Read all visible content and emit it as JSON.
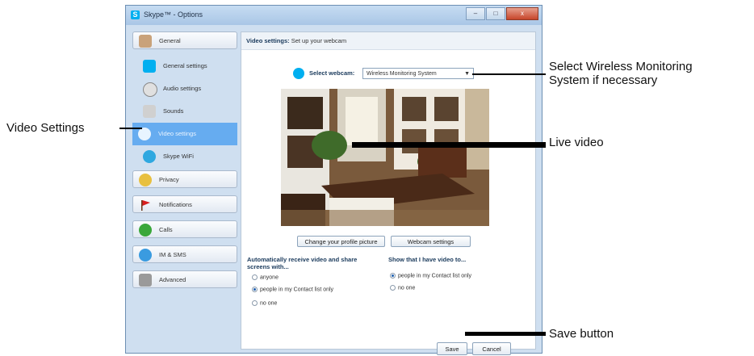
{
  "window": {
    "title": "Skype™ - Options",
    "close_label": "x"
  },
  "sidebar": {
    "categories": [
      {
        "label": "General"
      },
      {
        "label": "Privacy"
      },
      {
        "label": "Notifications"
      },
      {
        "label": "Calls"
      },
      {
        "label": "IM & SMS"
      },
      {
        "label": "Advanced"
      }
    ],
    "subitems": [
      {
        "label": "General settings"
      },
      {
        "label": "Audio settings"
      },
      {
        "label": "Sounds"
      },
      {
        "label": "Video settings"
      },
      {
        "label": "Skype WiFi"
      }
    ]
  },
  "content": {
    "header_title": "Video settings:",
    "header_subtitle": "Set up your webcam",
    "select_webcam_label": "Select webcam:",
    "webcam_value": "Wireless Monitoring System",
    "change_picture_button": "Change your profile picture",
    "webcam_settings_button": "Webcam settings",
    "auto_receive_title": "Automatically receive video and share screens with...",
    "auto_receive_options": [
      "anyone",
      "people in my Contact list only",
      "no one"
    ],
    "show_video_title": "Show that I have video to...",
    "show_video_options": [
      "people in my Contact list only",
      "no one"
    ]
  },
  "footer": {
    "save_button": "Save",
    "cancel_button": "Cancel"
  },
  "callouts": {
    "video_settings": "Video Settings",
    "select_wireless_line1": "Select Wireless Monitoring",
    "select_wireless_line2": "System if necessary",
    "live_video": "Live video",
    "save_button": "Save button"
  },
  "colors": {
    "active_item": "#66acf0",
    "skype_blue": "#00aff0"
  }
}
